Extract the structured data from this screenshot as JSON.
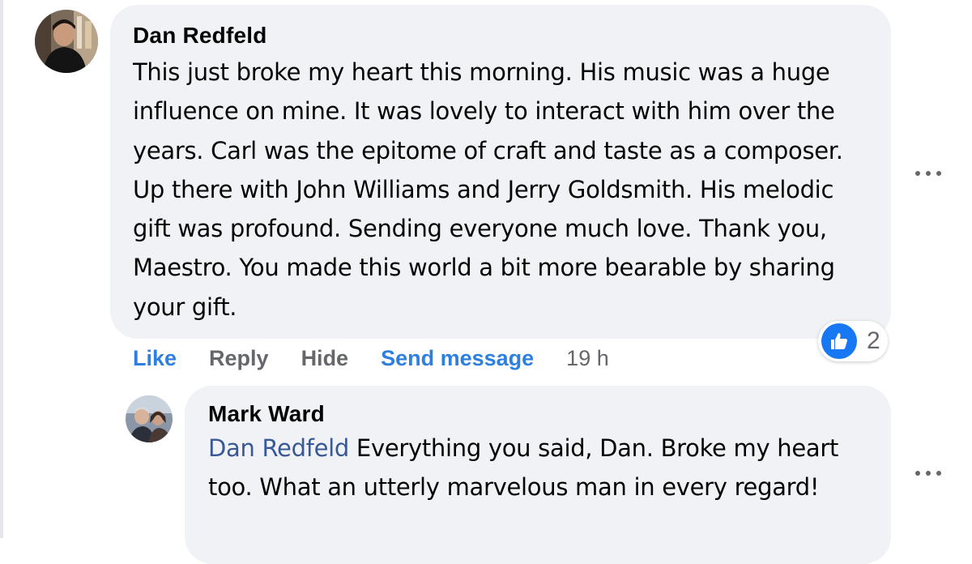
{
  "comment": {
    "author": "Dan Redfeld",
    "text": "This just broke my heart this morning. His music was a huge influence on mine. It was lovely to interact with him over the years. Carl was the epitome of craft and taste as a composer. Up there with John Williams and Jerry Goldsmith. His melodic gift was profound. Sending everyone much love. Thank you, Maestro. You made this world a bit more bearable by sharing your gift.",
    "actions": {
      "like": "Like",
      "reply": "Reply",
      "hide": "Hide",
      "send_message": "Send message",
      "timestamp": "19 h"
    },
    "reactions": {
      "icon": "thumbs-up-icon",
      "count": "2"
    }
  },
  "reply": {
    "author": "Mark Ward",
    "mention": "Dan Redfeld",
    "text": " Everything you said, Dan. Broke my heart too. What an utterly marvelous man in every regard!"
  },
  "colors": {
    "bubble": "#f0f2f5",
    "link_blue": "#2d7fe0",
    "mention_blue": "#385898",
    "secondary_text": "#65676b",
    "like_badge": "#1877f2"
  }
}
